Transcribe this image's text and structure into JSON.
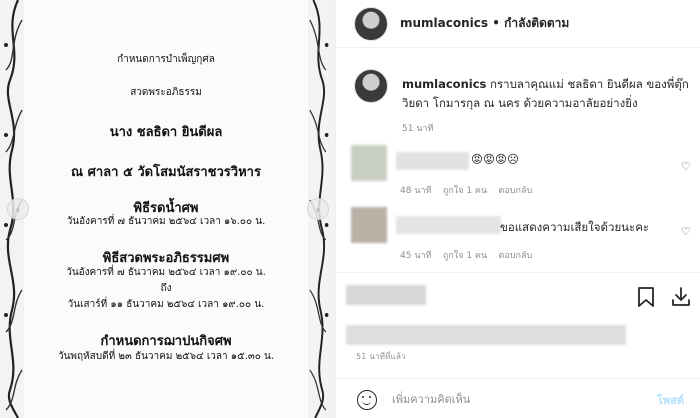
{
  "post_image": {
    "lines": [
      "กำหนดการบำเพ็ญกุศล",
      "สวดพระอภิธรรม",
      "นาง ชลธิดา ยินดีผล",
      "ณ ศาลา ๕ วัดโสมนัสราชวรวิหาร",
      "พิธีรดน้ำศพ",
      "วันอังคารที่ ๗ ธันวาคม ๒๕๖๔ เวลา ๑๖.๐๐ น.",
      "พิธีสวดพระอภิธรรมศพ",
      "วันอังคารที่ ๗ ธันวาคม ๒๕๖๔ เวลา ๑๙.๐๐ น.",
      "ถึง",
      "วันเสาร์ที่ ๑๑ ธันวาคม ๒๕๖๔ เวลา ๑๙.๐๐ น.",
      "กำหนดการฌาปนกิจศพ",
      "วันพฤหัสบดีที่ ๒๓ ธันวาคม ๒๕๖๔ เวลา ๑๕.๓๐ น."
    ],
    "prev_icon": "chevron-left-icon",
    "next_icon": "chevron-right-icon",
    "prev_glyph": "‹",
    "next_glyph": "›"
  },
  "header": {
    "username": "mumlaconics",
    "separator": " • ",
    "follow_status": "กำลังติดตาม"
  },
  "caption": {
    "username": "mumlaconics",
    "text": "กราบลาคุณแม่ ชลธิดา ยินดีผล ของพี่ตุ๊ก",
    "text2": "วิยดา โกมารกุล ณ นคร ด้วยความอาลัยอย่างยิ่ง",
    "time": "51 นาที"
  },
  "comments": [
    {
      "text": "😡😡😡☹",
      "time": "48 นาที",
      "likes": "ถูกใจ 1 คน",
      "reply": "ตอบกลับ",
      "heart_icon": "heart-icon",
      "heart_glyph": "♡"
    },
    {
      "text": "ขอแสดงความเสียใจด้วยนะคะ",
      "time": "45 นาที",
      "likes": "ถูกใจ 1 คน",
      "reply": "ตอบกลับ",
      "heart_icon": "heart-icon",
      "heart_glyph": "♡"
    }
  ],
  "actions": {
    "bookmark_icon": "bookmark-icon",
    "download_icon": "download-icon",
    "post_time": "51 นาทีที่แล้ว"
  },
  "comment_bar": {
    "emoji_icon": "emoji-icon",
    "placeholder": "เพิ่มความคิดเห็น",
    "post_label": "โพสต์"
  },
  "colors": {
    "link": "#0095f6",
    "post_disabled": "#b2dffc",
    "muted": "#8e8e8e"
  }
}
